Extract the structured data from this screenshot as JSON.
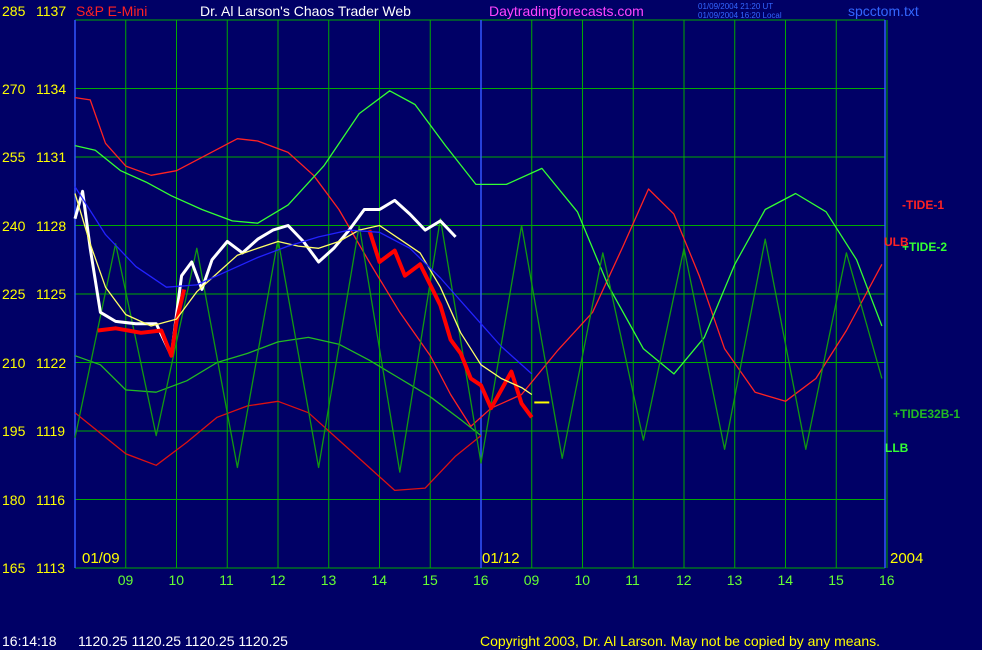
{
  "header": {
    "symbol": "S&P E-Mini",
    "title": "Dr. Al Larson's Chaos Trader Web",
    "site": "Daytradingforecasts.com",
    "file": "spcctom.txt",
    "time_ut": "01/09/2004 21:20 UT",
    "time_local": "01/09/2004 16:20 Local"
  },
  "footer": {
    "time": "16:14:18",
    "quotes": "1120.25 1120.25 1120.25 1120.25",
    "copyright": "Copyright 2003, Dr. Al Larson. May not be copied by any means."
  },
  "colors": {
    "background": "#000066",
    "grid": "#00aa00",
    "price_red": "#ff0000",
    "price_white": "#ffffff",
    "tide_red": "#cc0000",
    "tide_green": "#00aa00",
    "ma_yellow": "#ffff66",
    "ma_blue": "#0000ff",
    "label_yellow": "#ffff00",
    "label_green": "#66ff33"
  },
  "chart_data": {
    "type": "line",
    "y_left_labels": [
      "285",
      "270",
      "255",
      "240",
      "225",
      "210",
      "195",
      "180",
      "165"
    ],
    "y_right_labels": [
      "1137",
      "1134",
      "1131",
      "1128",
      "1125",
      "1122",
      "1119",
      "1116",
      "1113"
    ],
    "ylim": [
      1113,
      1137
    ],
    "x_hour_labels": [
      "09",
      "10",
      "11",
      "12",
      "13",
      "14",
      "15",
      "16",
      "09",
      "10",
      "11",
      "12",
      "13",
      "14",
      "15",
      "16"
    ],
    "date_labels": [
      "01/09",
      "01/12",
      "2004"
    ],
    "last_price": 1120.25,
    "series": [
      {
        "name": "-TIDE-1",
        "label": "-TIDE-1",
        "color": "#ff2222",
        "points": [
          [
            0,
            1133.6
          ],
          [
            0.3,
            1133.5
          ],
          [
            0.6,
            1131.6
          ],
          [
            1.0,
            1130.6
          ],
          [
            1.5,
            1130.2
          ],
          [
            2.0,
            1130.4
          ],
          [
            2.6,
            1131.1
          ],
          [
            3.2,
            1131.8
          ],
          [
            3.6,
            1131.7
          ],
          [
            4.2,
            1131.2
          ],
          [
            4.7,
            1130.2
          ],
          [
            5.2,
            1128.7
          ],
          [
            5.8,
            1126.4
          ],
          [
            6.4,
            1124.2
          ],
          [
            7.0,
            1122.3
          ],
          [
            7.4,
            1120.6
          ],
          [
            7.8,
            1119.2
          ],
          [
            8.2,
            1120.0
          ],
          [
            8.8,
            1120.6
          ],
          [
            9.5,
            1122.5
          ],
          [
            10.2,
            1124.2
          ],
          [
            10.8,
            1127.1
          ],
          [
            11.3,
            1129.6
          ],
          [
            11.8,
            1128.5
          ],
          [
            12.3,
            1125.8
          ],
          [
            12.8,
            1122.6
          ],
          [
            13.4,
            1120.7
          ],
          [
            14.0,
            1120.3
          ],
          [
            14.6,
            1121.3
          ],
          [
            15.2,
            1123.4
          ],
          [
            15.9,
            1126.3
          ]
        ]
      },
      {
        "name": "+TIDE-2",
        "label": "+TIDE-2",
        "color": "#33ff33",
        "points": [
          [
            0,
            1131.5
          ],
          [
            0.4,
            1131.3
          ],
          [
            0.9,
            1130.4
          ],
          [
            1.4,
            1129.9
          ],
          [
            1.9,
            1129.3
          ],
          [
            2.5,
            1128.7
          ],
          [
            3.1,
            1128.2
          ],
          [
            3.6,
            1128.1
          ],
          [
            4.2,
            1128.9
          ],
          [
            4.9,
            1130.6
          ],
          [
            5.6,
            1132.9
          ],
          [
            6.2,
            1133.9
          ],
          [
            6.7,
            1133.3
          ],
          [
            7.3,
            1131.5
          ],
          [
            7.9,
            1129.8
          ],
          [
            8.5,
            1129.8
          ],
          [
            9.2,
            1130.5
          ],
          [
            9.9,
            1128.6
          ],
          [
            10.5,
            1125.4
          ],
          [
            11.2,
            1122.6
          ],
          [
            11.8,
            1121.5
          ],
          [
            12.4,
            1123.1
          ],
          [
            13.0,
            1126.3
          ],
          [
            13.6,
            1128.7
          ],
          [
            14.2,
            1129.4
          ],
          [
            14.8,
            1128.6
          ],
          [
            15.4,
            1126.5
          ],
          [
            15.9,
            1123.6
          ]
        ]
      },
      {
        "name": "LLB",
        "label": "LLB",
        "color": "#22bb22",
        "points": [
          [
            0,
            1122.3
          ],
          [
            0.5,
            1121.9
          ],
          [
            1.0,
            1120.8
          ],
          [
            1.6,
            1120.7
          ],
          [
            2.2,
            1121.2
          ],
          [
            2.8,
            1122.0
          ],
          [
            3.4,
            1122.4
          ],
          [
            4.0,
            1122.9
          ],
          [
            4.6,
            1123.1
          ],
          [
            5.2,
            1122.8
          ],
          [
            5.8,
            1122.1
          ],
          [
            6.4,
            1121.3
          ],
          [
            7.0,
            1120.5
          ],
          [
            7.6,
            1119.5
          ],
          [
            8.0,
            1118.8
          ]
        ]
      },
      {
        "name": "ULB",
        "label": "ULB",
        "color": "#dd1111",
        "points": [
          [
            0,
            1119.8
          ],
          [
            0.5,
            1118.9
          ],
          [
            1.0,
            1118.0
          ],
          [
            1.6,
            1117.5
          ],
          [
            2.2,
            1118.5
          ],
          [
            2.8,
            1119.6
          ],
          [
            3.4,
            1120.1
          ],
          [
            4.0,
            1120.3
          ],
          [
            4.6,
            1119.8
          ],
          [
            5.2,
            1118.6
          ],
          [
            5.8,
            1117.4
          ],
          [
            6.3,
            1116.4
          ],
          [
            6.9,
            1116.5
          ],
          [
            7.5,
            1117.9
          ],
          [
            8.0,
            1118.8
          ]
        ]
      },
      {
        "name": "+TIDE32B-1",
        "label": "+TIDE32B-1",
        "color": "#119911",
        "points": [
          [
            0,
            1118.7
          ],
          [
            0.8,
            1127.2
          ],
          [
            1.6,
            1118.8
          ],
          [
            2.4,
            1127.0
          ],
          [
            3.2,
            1117.4
          ],
          [
            4.0,
            1127.4
          ],
          [
            4.8,
            1117.4
          ],
          [
            5.6,
            1128.0
          ],
          [
            6.4,
            1117.2
          ],
          [
            7.2,
            1128.3
          ],
          [
            8.0,
            1117.6
          ],
          [
            8.8,
            1128.0
          ],
          [
            9.6,
            1117.8
          ],
          [
            10.4,
            1126.8
          ],
          [
            11.2,
            1118.6
          ],
          [
            12.0,
            1127.0
          ],
          [
            12.8,
            1118.2
          ],
          [
            13.6,
            1127.4
          ],
          [
            14.4,
            1118.2
          ],
          [
            15.2,
            1126.8
          ],
          [
            15.9,
            1121.3
          ]
        ]
      },
      {
        "name": "price",
        "label": "",
        "color": "#ffffff",
        "points": [
          [
            0,
            1128.3
          ],
          [
            0.15,
            1129.5
          ],
          [
            0.3,
            1127.0
          ],
          [
            0.5,
            1124.2
          ],
          [
            0.8,
            1123.8
          ],
          [
            1.2,
            1123.7
          ],
          [
            1.6,
            1123.7
          ],
          [
            1.9,
            1122.3
          ],
          [
            2.0,
            1124.1
          ],
          [
            2.1,
            1125.8
          ],
          [
            2.3,
            1126.4
          ],
          [
            2.5,
            1125.2
          ],
          [
            2.7,
            1126.5
          ],
          [
            3.0,
            1127.3
          ],
          [
            3.3,
            1126.8
          ],
          [
            3.6,
            1127.4
          ],
          [
            3.9,
            1127.8
          ],
          [
            4.2,
            1128.0
          ],
          [
            4.5,
            1127.3
          ],
          [
            4.8,
            1126.4
          ],
          [
            5.1,
            1127.0
          ],
          [
            5.4,
            1127.8
          ],
          [
            5.7,
            1128.7
          ],
          [
            6.0,
            1128.7
          ],
          [
            6.3,
            1129.1
          ],
          [
            6.6,
            1128.5
          ],
          [
            6.9,
            1127.8
          ],
          [
            7.2,
            1128.2
          ],
          [
            7.5,
            1127.5
          ]
        ]
      },
      {
        "name": "price-red",
        "label": "",
        "color": "#ff0000",
        "points": [
          [
            0.45,
            1123.4
          ],
          [
            0.8,
            1123.5
          ],
          [
            1.3,
            1123.3
          ],
          [
            1.7,
            1123.4
          ],
          [
            1.9,
            1122.3
          ],
          [
            2.0,
            1123.8
          ],
          [
            2.15,
            1125.2
          ]
        ]
      },
      {
        "name": "price-red-late",
        "label": "",
        "color": "#ff0000",
        "points": [
          [
            5.8,
            1127.8
          ],
          [
            6.0,
            1126.4
          ],
          [
            6.3,
            1126.9
          ],
          [
            6.5,
            1125.8
          ],
          [
            6.8,
            1126.3
          ],
          [
            7.0,
            1125.4
          ],
          [
            7.2,
            1124.5
          ],
          [
            7.4,
            1123.0
          ],
          [
            7.6,
            1122.4
          ],
          [
            7.8,
            1121.3
          ],
          [
            8.0,
            1121.0
          ],
          [
            8.2,
            1120.0
          ],
          [
            8.4,
            1120.8
          ],
          [
            8.6,
            1121.6
          ],
          [
            8.8,
            1120.2
          ],
          [
            9.0,
            1119.6
          ]
        ]
      },
      {
        "name": "yellow-ma",
        "label": "",
        "color": "#ffff66",
        "points": [
          [
            0,
            1129.4
          ],
          [
            0.3,
            1127.2
          ],
          [
            0.6,
            1125.3
          ],
          [
            1.0,
            1124.1
          ],
          [
            1.5,
            1123.6
          ],
          [
            2.0,
            1123.9
          ],
          [
            2.4,
            1125.1
          ],
          [
            2.8,
            1125.9
          ],
          [
            3.2,
            1126.7
          ],
          [
            3.6,
            1127.0
          ],
          [
            4.0,
            1127.3
          ],
          [
            4.4,
            1127.1
          ],
          [
            4.8,
            1127.0
          ],
          [
            5.2,
            1127.3
          ],
          [
            5.6,
            1127.8
          ],
          [
            6.0,
            1128.0
          ],
          [
            6.4,
            1127.4
          ],
          [
            6.8,
            1126.8
          ],
          [
            7.2,
            1125.3
          ],
          [
            7.6,
            1123.3
          ],
          [
            8.0,
            1121.9
          ],
          [
            8.4,
            1121.3
          ],
          [
            8.8,
            1120.9
          ],
          [
            9.0,
            1120.6
          ]
        ]
      },
      {
        "name": "blue-ma",
        "label": "",
        "color": "#2222ff",
        "points": [
          [
            0,
            1129.7
          ],
          [
            0.6,
            1127.6
          ],
          [
            1.2,
            1126.2
          ],
          [
            1.8,
            1125.3
          ],
          [
            2.4,
            1125.4
          ],
          [
            3.0,
            1126.0
          ],
          [
            3.6,
            1126.6
          ],
          [
            4.2,
            1127.1
          ],
          [
            4.8,
            1127.5
          ],
          [
            5.4,
            1127.8
          ],
          [
            6.0,
            1127.7
          ],
          [
            6.6,
            1127.0
          ],
          [
            7.2,
            1125.7
          ],
          [
            7.8,
            1124.2
          ],
          [
            8.4,
            1122.7
          ],
          [
            9.0,
            1121.5
          ]
        ]
      }
    ]
  }
}
